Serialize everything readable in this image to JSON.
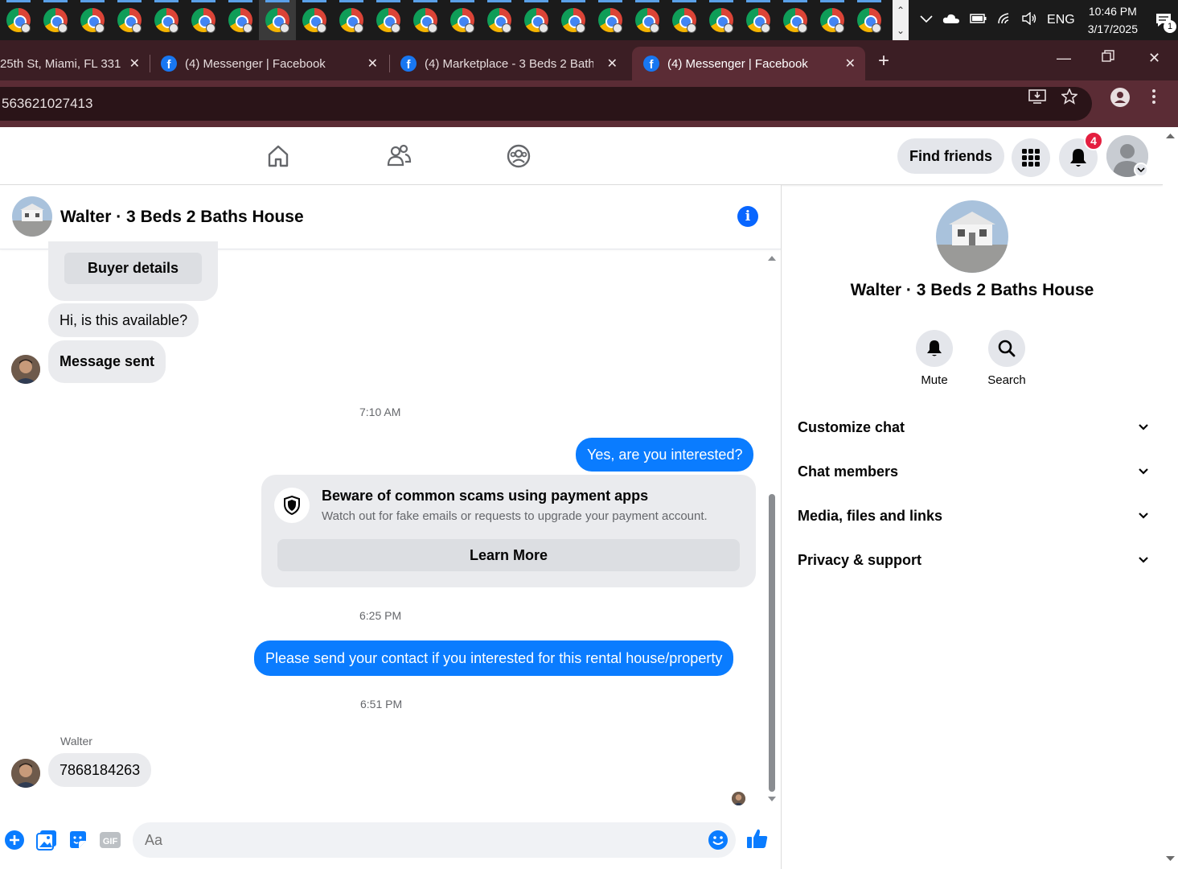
{
  "taskbar": {
    "app_count": 24,
    "active_index": 7,
    "tray": {
      "language": "ENG",
      "time": "10:46 PM",
      "date": "3/17/2025",
      "notification_count": "1"
    }
  },
  "browser": {
    "tabs": [
      {
        "title": "25th St, Miami, FL 331",
        "active": false
      },
      {
        "title": "(4) Messenger | Facebook",
        "active": false
      },
      {
        "title": "(4) Marketplace - 3 Beds 2 Bath",
        "active": false
      },
      {
        "title": "(4) Messenger | Facebook",
        "active": true
      }
    ],
    "url": "563621027413"
  },
  "fb_header": {
    "find_friends": "Find friends",
    "notification_badge": "4"
  },
  "chat": {
    "title": "Walter · 3 Beds 2 Baths House",
    "buyer_details_label": "Buyer details",
    "messages": {
      "m1": "Hi, is this available?",
      "m2": "Message sent",
      "ts1": "7:10 AM",
      "m3": "Yes, are you interested?",
      "ts2": "6:25 PM",
      "m4": "Please send your contact if you interested for this rental house/property",
      "ts3": "6:51 PM",
      "sender_name": "Walter",
      "m5": "7868184263"
    },
    "scam_notice": {
      "title": "Beware of common scams using payment apps",
      "subtitle": "Watch out for fake emails or requests to upgrade your payment account.",
      "button": "Learn More"
    },
    "composer": {
      "placeholder": "Aa"
    }
  },
  "right_panel": {
    "name": "Walter · 3 Beds 2 Baths House",
    "actions": {
      "mute": "Mute",
      "search": "Search"
    },
    "sections": [
      "Customize chat",
      "Chat members",
      "Media, files and links",
      "Privacy & support"
    ]
  },
  "colors": {
    "messenger_blue": "#0a7cff",
    "facebook_blue": "#1877f2",
    "badge_red": "#e41e3f",
    "tab_bar": "#3b1e24",
    "address_bar": "#5b2c35"
  }
}
